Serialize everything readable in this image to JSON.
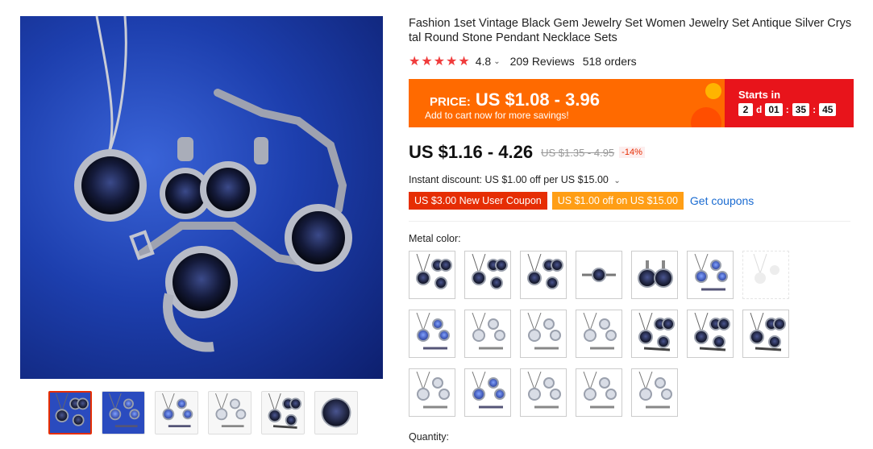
{
  "product": {
    "title": "Fashion 1set Vintage Black Gem Jewelry Set Women Jewelry Set Antique Silver Crystal Round Stone Pendant Necklace Sets",
    "stars": "★★★★★",
    "rating": "4.8",
    "reviews": "209 Reviews",
    "orders": "518 orders"
  },
  "promo": {
    "price_label": "PRICE:",
    "price_range": "US $1.08 - 3.96",
    "subtext": "Add to cart now for more savings!",
    "starts_in_label": "Starts in",
    "countdown": {
      "days": "2",
      "days_unit": "d",
      "hours": "01",
      "minutes": "35",
      "seconds": "45"
    },
    "colors": {
      "banner": "#ff6a00",
      "countdown": "#e8141b"
    }
  },
  "pricing": {
    "current": "US $1.16 - 4.26",
    "original": "US $1.35 - 4.95",
    "discount": "-14%",
    "instant_discount": "Instant discount: US $1.00 off per US $15.00"
  },
  "coupons": {
    "new_user": "US $3.00 New User Coupon",
    "store": "US $1.00 off on US $15.00",
    "get_link": "Get coupons"
  },
  "variants": {
    "label": "Metal color:",
    "options": [
      {
        "kind": "earrings"
      },
      {
        "kind": "earrings"
      },
      {
        "kind": "earrings"
      },
      {
        "kind": "bracelet"
      },
      {
        "kind": "drops"
      },
      {
        "kind": "blue-set"
      },
      {
        "kind": "faded",
        "disabled": true
      },
      {
        "kind": "blue-set"
      },
      {
        "kind": "silver-set"
      },
      {
        "kind": "silver-set"
      },
      {
        "kind": "silver-set"
      },
      {
        "kind": "full-set"
      },
      {
        "kind": "full-set"
      },
      {
        "kind": "full-set"
      },
      {
        "kind": "silver-set"
      },
      {
        "kind": "blue-set"
      },
      {
        "kind": "silver-set"
      },
      {
        "kind": "silver-set"
      },
      {
        "kind": "silver-set"
      }
    ]
  },
  "quantity_label": "Quantity:",
  "gallery": {
    "thumbnails": [
      {
        "kind": "main",
        "active": true
      },
      {
        "kind": "model"
      },
      {
        "kind": "blue-set"
      },
      {
        "kind": "silver-set"
      },
      {
        "kind": "full-set"
      },
      {
        "kind": "closeup"
      }
    ]
  }
}
